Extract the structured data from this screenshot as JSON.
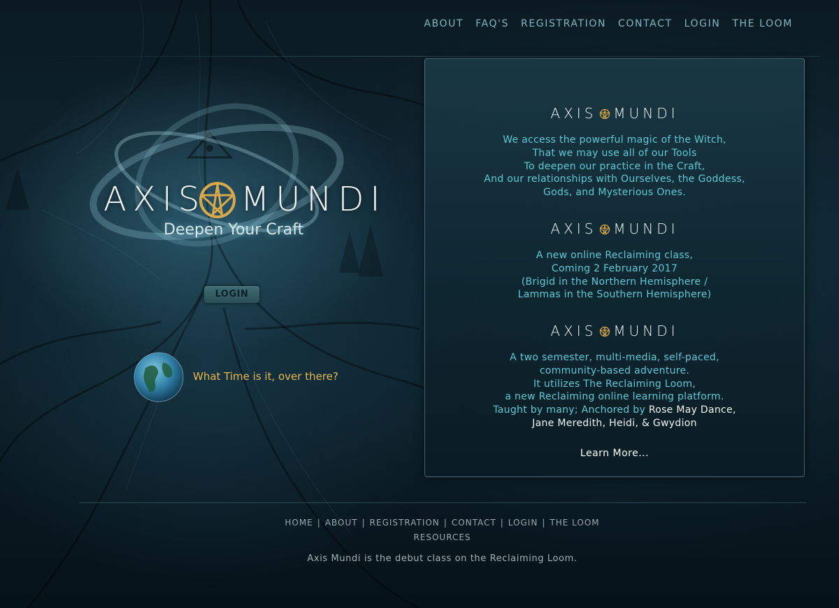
{
  "nav": {
    "items": [
      "ABOUT",
      "FAQ'S",
      "REGISTRATION",
      "CONTACT",
      "LOGIN",
      "THE LOOM"
    ]
  },
  "hero": {
    "logo_left": "AXIS",
    "logo_right": "MUNDI",
    "tagline": "Deepen Your Craft",
    "login_label": "LOGIN",
    "time_link": "What Time is it, over there?"
  },
  "panel": {
    "logo_left": "AXIS",
    "logo_right": "MUNDI",
    "block1": [
      "We access the powerful magic of the Witch,",
      "That we may use all of our Tools",
      "To deepen our practice in the Craft,",
      "And our relationships with Ourselves, the Goddess,",
      "Gods, and Mysterious Ones."
    ],
    "block2": [
      "A new online Reclaiming class,",
      "Coming 2 February 2017",
      "(Brigid in the Northern Hemisphere /",
      "Lammas in the Southern Hemisphere)"
    ],
    "block3": [
      "A two semester, multi-media, self-paced,",
      "community-based adventure.",
      "It utilizes The Reclaiming Loom,",
      "a new Reclaiming online learning platform."
    ],
    "taught_prefix": "Taught by many; Anchored by ",
    "anchors": [
      "Rose May Dance",
      "Jane Meredith",
      "Heidi",
      "Gwydion"
    ],
    "learn_more": "Learn More..."
  },
  "footer": {
    "nav": [
      "HOME",
      "ABOUT",
      "REGISTRATION",
      "CONTACT",
      "LOGIN",
      "THE LOOM"
    ],
    "nav2": "RESOURCES",
    "text": "Axis Mundi is the debut class on the Reclaiming Loom."
  },
  "colors": {
    "accent": "#5ec9d6",
    "gold": "#e8b84a",
    "nav": "#7fb7c2"
  }
}
